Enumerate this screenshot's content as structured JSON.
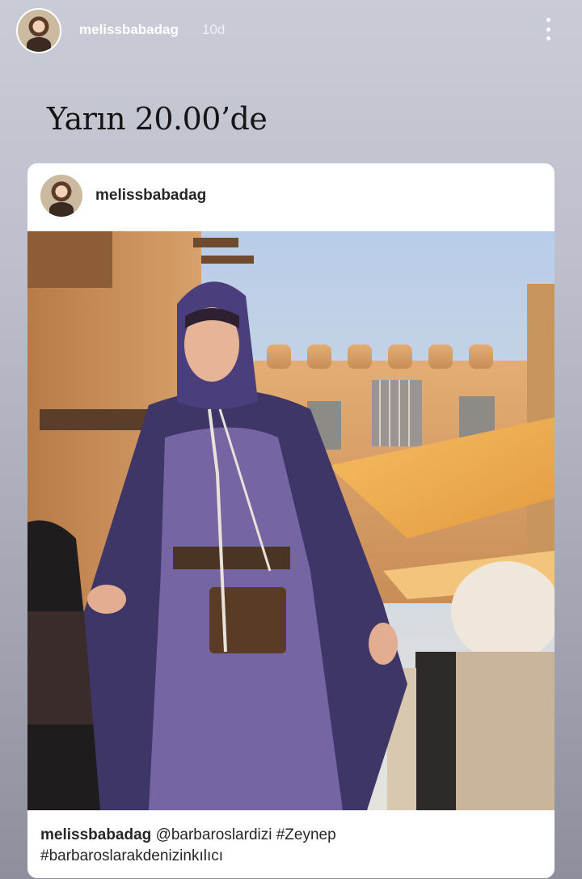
{
  "story": {
    "username": "melissbabadag",
    "time": "10d",
    "text": "Yarın 20.00’de"
  },
  "post": {
    "username": "melissbabadag",
    "caption_user": "melissbabadag",
    "caption_line1": "@barbaroslardizi #Zeynep",
    "caption_line2": "#barbaroslarakdenizinkılıcı"
  },
  "icons": {
    "more": "vertical-ellipsis-icon"
  },
  "colors": {
    "sky": "#c8d9ef",
    "wall": "#d9a36c",
    "awning": "#f2b258",
    "cloak": "#4a3f7a",
    "dress": "#7b6aa8"
  }
}
